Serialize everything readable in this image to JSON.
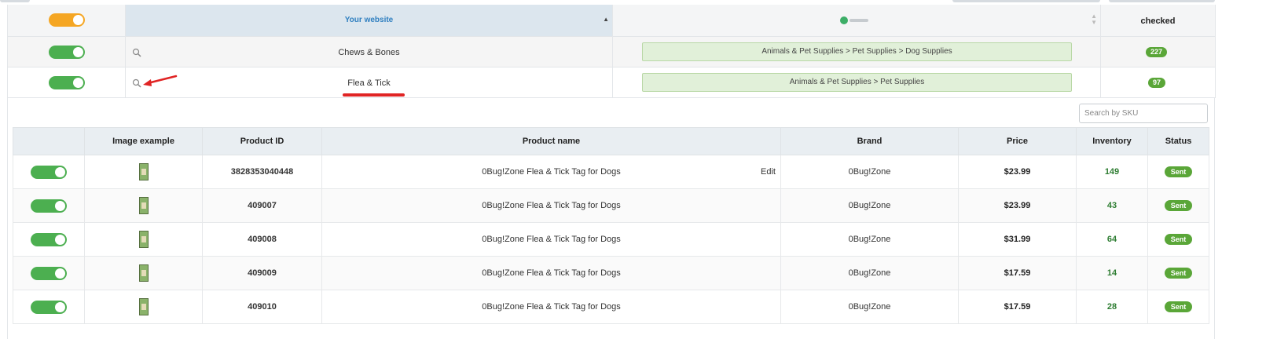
{
  "category_table": {
    "header": {
      "website_label": "Your website",
      "checked_label": "checked",
      "target_logo": "green-circle-logo",
      "master_toggle_color": "#f5a623"
    },
    "rows": [
      {
        "name": "Chews & Bones",
        "path": "Animals & Pet Supplies > Pet Supplies > Dog Supplies",
        "count": "227",
        "enabled": true
      },
      {
        "name": "Flea & Tick",
        "path": "Animals & Pet Supplies > Pet Supplies",
        "count": "97",
        "enabled": true
      }
    ]
  },
  "annotation": {
    "color": "#e02424"
  },
  "sku_search": {
    "placeholder": "Search by SKU",
    "value": ""
  },
  "products": {
    "columns": [
      "Image example",
      "Product ID",
      "Product name",
      "Brand",
      "Price",
      "Inventory",
      "Status"
    ],
    "edit_label": "Edit",
    "rows": [
      {
        "id": "3828353040448",
        "name": "0Bug!Zone Flea & Tick Tag for Dogs",
        "brand": "0Bug!Zone",
        "price": "$23.99",
        "inventory": "149",
        "status": "Sent"
      },
      {
        "id": "409007",
        "name": "0Bug!Zone Flea & Tick Tag for Dogs",
        "brand": "0Bug!Zone",
        "price": "$23.99",
        "inventory": "43",
        "status": "Sent"
      },
      {
        "id": "409008",
        "name": "0Bug!Zone Flea & Tick Tag for Dogs",
        "brand": "0Bug!Zone",
        "price": "$31.99",
        "inventory": "64",
        "status": "Sent"
      },
      {
        "id": "409009",
        "name": "0Bug!Zone Flea & Tick Tag for Dogs",
        "brand": "0Bug!Zone",
        "price": "$17.59",
        "inventory": "14",
        "status": "Sent"
      },
      {
        "id": "409010",
        "name": "0Bug!Zone Flea & Tick Tag for Dogs",
        "brand": "0Bug!Zone",
        "price": "$17.59",
        "inventory": "28",
        "status": "Sent"
      }
    ]
  },
  "colors": {
    "toggle_on": "#4caf50",
    "badge_green": "#5aa638",
    "inventory_green": "#2e7d32",
    "header_link": "#2f7fc0"
  }
}
